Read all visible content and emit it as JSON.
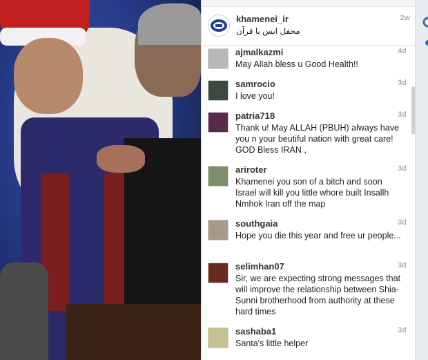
{
  "caption": {
    "username": "khamenei_ir",
    "text": "محفل انس با قرآن",
    "time": "2w",
    "avatar_icon": "seal-icon"
  },
  "comments": [
    {
      "username": "ajmalkazmi",
      "time": "4d",
      "text": "May Allah bless u Good Health!!",
      "avatar_color": "#b8b8b8"
    },
    {
      "username": "samrocio",
      "time": "3d",
      "text": "I love you!",
      "avatar_color": "#3b4a3d"
    },
    {
      "username": "patria718",
      "time": "3d",
      "text": "Thank u! May ALLAH (PBUH) always have you n your beutiful nation with great care! GOD Bless IRAN ,",
      "avatar_color": "#5a2a4a"
    },
    {
      "username": "ariroter",
      "time": "3d",
      "text": "Khamenei you son of a bitch and soon Israel will kill you little whore built Insallh Nmhok Iran off the map",
      "avatar_color": "#7a8f6a"
    },
    {
      "username": "southgaia",
      "time": "3d",
      "text": "Hope you die this year and free ur people...",
      "avatar_color": "#a89a8a"
    },
    {
      "username": "selimhan07",
      "time": "3d",
      "text": "Sir, we are expecting strong messages that will improve the relationship between Shia-Sunni brotherhood from authority at these hard times",
      "avatar_color": "#6a2a20"
    },
    {
      "username": "sashaba1",
      "time": "3d",
      "text": "Santa's little helper",
      "avatar_color": "#c8c090"
    }
  ]
}
